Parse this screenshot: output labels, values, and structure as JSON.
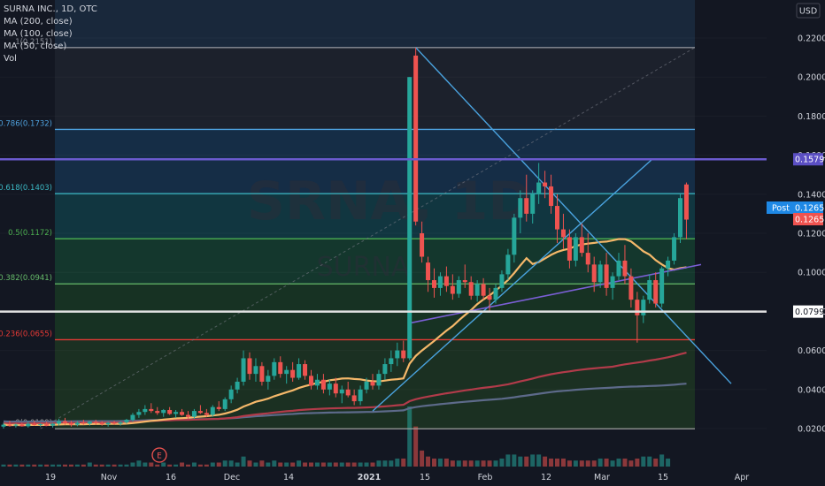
{
  "header": {
    "symbol_line": "SURNA INC., 1D, OTC",
    "indicators": [
      "MA (200, close)",
      "MA (100, close)",
      "MA (50, close)",
      "Vol"
    ]
  },
  "watermark": {
    "ticker": "SRNA, 1D",
    "name": "SURNA"
  },
  "currency_badge": "USD",
  "colors": {
    "background": "#131722",
    "up": "#26a69a",
    "down": "#ef5350",
    "ma50": "#f5b86a",
    "ma100": "#b23b4a",
    "ma200": "#5d6a8a",
    "trend_line": "#4aa3df",
    "channel_line": "#7b5fd6"
  },
  "chart_data": {
    "type": "candlestick",
    "y_axis": {
      "range": [
        0.01,
        0.235
      ],
      "ticks": [
        "0.2200",
        "0.2000",
        "0.1800",
        "0.1600",
        "0.1400",
        "0.1200",
        "0.1000",
        "0.0800",
        "0.0600",
        "0.0400",
        "0.0200"
      ]
    },
    "x_axis": {
      "ticks": [
        "19",
        "Nov",
        "16",
        "Dec",
        "14",
        "2021",
        "15",
        "Feb",
        "12",
        "Mar",
        "15",
        "Apr"
      ]
    },
    "price_labels": [
      {
        "label": "0.1579",
        "value": 0.1579,
        "color": "#5b4fc4"
      },
      {
        "label": "Post",
        "value": 0.1265,
        "color": "#1e88e5"
      },
      {
        "label": "0.1265",
        "value": 0.1265,
        "color": "#1e88e5"
      },
      {
        "label": "0.1265",
        "value": 0.1255,
        "color": "#ef5350"
      },
      {
        "label": "0.0799",
        "value": 0.0799,
        "color": "#ffffff"
      }
    ],
    "fibonacci": {
      "levels": [
        {
          "label": "1(0.2151)",
          "value": 0.2151,
          "color": "#8a8f99"
        },
        {
          "label": "0.786(0.1732)",
          "value": 0.1732,
          "color": "#4fa3e0"
        },
        {
          "label": "0.618(0.1403)",
          "value": 0.1403,
          "color": "#3cbac6"
        },
        {
          "label": "0.5(0.1172)",
          "value": 0.1172,
          "color": "#4caf50"
        },
        {
          "label": "0.382(0.0941)",
          "value": 0.0941,
          "color": "#66bb6a"
        },
        {
          "label": "0.236(0.0655)",
          "value": 0.0655,
          "color": "#e53935"
        },
        {
          "label": "0(0.0199)",
          "value": 0.0199,
          "color": "#9e9e9e"
        }
      ]
    },
    "horizontal_lines": [
      {
        "value": 0.1579,
        "color": "#6a5acd"
      },
      {
        "value": 0.0799,
        "color": "#e0e0e0"
      }
    ],
    "events": [
      {
        "label": "E"
      }
    ],
    "candles": [
      {
        "o": 0.021,
        "h": 0.023,
        "l": 0.02,
        "c": 0.022
      },
      {
        "o": 0.022,
        "h": 0.024,
        "l": 0.021,
        "c": 0.0215
      },
      {
        "o": 0.0215,
        "h": 0.0225,
        "l": 0.0205,
        "c": 0.022
      },
      {
        "o": 0.022,
        "h": 0.023,
        "l": 0.021,
        "c": 0.0212
      },
      {
        "o": 0.0212,
        "h": 0.0235,
        "l": 0.0205,
        "c": 0.0225
      },
      {
        "o": 0.0225,
        "h": 0.024,
        "l": 0.0215,
        "c": 0.0218
      },
      {
        "o": 0.0218,
        "h": 0.0228,
        "l": 0.0208,
        "c": 0.0222
      },
      {
        "o": 0.0222,
        "h": 0.0235,
        "l": 0.0212,
        "c": 0.0215
      },
      {
        "o": 0.0215,
        "h": 0.023,
        "l": 0.0205,
        "c": 0.0225
      },
      {
        "o": 0.0225,
        "h": 0.025,
        "l": 0.0215,
        "c": 0.0238
      },
      {
        "o": 0.0238,
        "h": 0.0255,
        "l": 0.022,
        "c": 0.0228
      },
      {
        "o": 0.0228,
        "h": 0.024,
        "l": 0.021,
        "c": 0.022
      },
      {
        "o": 0.022,
        "h": 0.0238,
        "l": 0.0212,
        "c": 0.023
      },
      {
        "o": 0.023,
        "h": 0.0245,
        "l": 0.022,
        "c": 0.0225
      },
      {
        "o": 0.0225,
        "h": 0.024,
        "l": 0.0215,
        "c": 0.0235
      },
      {
        "o": 0.0235,
        "h": 0.0245,
        "l": 0.022,
        "c": 0.0228
      },
      {
        "o": 0.0228,
        "h": 0.0238,
        "l": 0.0215,
        "c": 0.0222
      },
      {
        "o": 0.0222,
        "h": 0.0235,
        "l": 0.021,
        "c": 0.023
      },
      {
        "o": 0.023,
        "h": 0.024,
        "l": 0.022,
        "c": 0.0225
      },
      {
        "o": 0.0225,
        "h": 0.0238,
        "l": 0.0215,
        "c": 0.0232
      },
      {
        "o": 0.0232,
        "h": 0.025,
        "l": 0.0225,
        "c": 0.0245
      },
      {
        "o": 0.0245,
        "h": 0.028,
        "l": 0.0235,
        "c": 0.027
      },
      {
        "o": 0.027,
        "h": 0.03,
        "l": 0.0255,
        "c": 0.0285
      },
      {
        "o": 0.0285,
        "h": 0.032,
        "l": 0.027,
        "c": 0.03
      },
      {
        "o": 0.03,
        "h": 0.033,
        "l": 0.028,
        "c": 0.029
      },
      {
        "o": 0.029,
        "h": 0.031,
        "l": 0.027,
        "c": 0.028
      },
      {
        "o": 0.028,
        "h": 0.03,
        "l": 0.026,
        "c": 0.0295
      },
      {
        "o": 0.0295,
        "h": 0.031,
        "l": 0.027,
        "c": 0.0275
      },
      {
        "o": 0.0275,
        "h": 0.0295,
        "l": 0.0255,
        "c": 0.0285
      },
      {
        "o": 0.0285,
        "h": 0.03,
        "l": 0.0265,
        "c": 0.027
      },
      {
        "o": 0.027,
        "h": 0.029,
        "l": 0.025,
        "c": 0.026
      },
      {
        "o": 0.026,
        "h": 0.03,
        "l": 0.025,
        "c": 0.029
      },
      {
        "o": 0.029,
        "h": 0.032,
        "l": 0.0275,
        "c": 0.028
      },
      {
        "o": 0.028,
        "h": 0.03,
        "l": 0.026,
        "c": 0.027
      },
      {
        "o": 0.027,
        "h": 0.032,
        "l": 0.026,
        "c": 0.031
      },
      {
        "o": 0.031,
        "h": 0.034,
        "l": 0.029,
        "c": 0.03
      },
      {
        "o": 0.03,
        "h": 0.036,
        "l": 0.029,
        "c": 0.035
      },
      {
        "o": 0.035,
        "h": 0.042,
        "l": 0.033,
        "c": 0.04
      },
      {
        "o": 0.04,
        "h": 0.046,
        "l": 0.038,
        "c": 0.044
      },
      {
        "o": 0.044,
        "h": 0.06,
        "l": 0.042,
        "c": 0.056
      },
      {
        "o": 0.056,
        "h": 0.059,
        "l": 0.045,
        "c": 0.048
      },
      {
        "o": 0.048,
        "h": 0.056,
        "l": 0.044,
        "c": 0.052
      },
      {
        "o": 0.052,
        "h": 0.054,
        "l": 0.042,
        "c": 0.044
      },
      {
        "o": 0.044,
        "h": 0.05,
        "l": 0.04,
        "c": 0.047
      },
      {
        "o": 0.047,
        "h": 0.056,
        "l": 0.045,
        "c": 0.054
      },
      {
        "o": 0.054,
        "h": 0.057,
        "l": 0.046,
        "c": 0.048
      },
      {
        "o": 0.048,
        "h": 0.052,
        "l": 0.043,
        "c": 0.05
      },
      {
        "o": 0.05,
        "h": 0.054,
        "l": 0.044,
        "c": 0.046
      },
      {
        "o": 0.046,
        "h": 0.056,
        "l": 0.045,
        "c": 0.053
      },
      {
        "o": 0.053,
        "h": 0.055,
        "l": 0.045,
        "c": 0.047
      },
      {
        "o": 0.047,
        "h": 0.05,
        "l": 0.04,
        "c": 0.042
      },
      {
        "o": 0.042,
        "h": 0.048,
        "l": 0.04,
        "c": 0.045
      },
      {
        "o": 0.045,
        "h": 0.048,
        "l": 0.038,
        "c": 0.04
      },
      {
        "o": 0.04,
        "h": 0.045,
        "l": 0.037,
        "c": 0.043
      },
      {
        "o": 0.043,
        "h": 0.046,
        "l": 0.036,
        "c": 0.038
      },
      {
        "o": 0.038,
        "h": 0.042,
        "l": 0.033,
        "c": 0.04
      },
      {
        "o": 0.04,
        "h": 0.044,
        "l": 0.036,
        "c": 0.037
      },
      {
        "o": 0.037,
        "h": 0.04,
        "l": 0.032,
        "c": 0.034
      },
      {
        "o": 0.034,
        "h": 0.042,
        "l": 0.032,
        "c": 0.04
      },
      {
        "o": 0.04,
        "h": 0.046,
        "l": 0.038,
        "c": 0.044
      },
      {
        "o": 0.044,
        "h": 0.048,
        "l": 0.04,
        "c": 0.042
      },
      {
        "o": 0.042,
        "h": 0.05,
        "l": 0.04,
        "c": 0.048
      },
      {
        "o": 0.048,
        "h": 0.056,
        "l": 0.045,
        "c": 0.053
      },
      {
        "o": 0.053,
        "h": 0.06,
        "l": 0.049,
        "c": 0.056
      },
      {
        "o": 0.056,
        "h": 0.064,
        "l": 0.052,
        "c": 0.06
      },
      {
        "o": 0.06,
        "h": 0.065,
        "l": 0.054,
        "c": 0.056
      },
      {
        "o": 0.056,
        "h": 0.2,
        "l": 0.055,
        "c": 0.2
      },
      {
        "o": 0.211,
        "h": 0.215,
        "l": 0.124,
        "c": 0.126
      },
      {
        "o": 0.12,
        "h": 0.126,
        "l": 0.105,
        "c": 0.108
      },
      {
        "o": 0.105,
        "h": 0.108,
        "l": 0.09,
        "c": 0.096
      },
      {
        "o": 0.096,
        "h": 0.102,
        "l": 0.087,
        "c": 0.092
      },
      {
        "o": 0.092,
        "h": 0.1,
        "l": 0.088,
        "c": 0.098
      },
      {
        "o": 0.098,
        "h": 0.103,
        "l": 0.09,
        "c": 0.093
      },
      {
        "o": 0.093,
        "h": 0.099,
        "l": 0.086,
        "c": 0.089
      },
      {
        "o": 0.089,
        "h": 0.098,
        "l": 0.087,
        "c": 0.096
      },
      {
        "o": 0.096,
        "h": 0.104,
        "l": 0.092,
        "c": 0.095
      },
      {
        "o": 0.095,
        "h": 0.098,
        "l": 0.086,
        "c": 0.088
      },
      {
        "o": 0.088,
        "h": 0.096,
        "l": 0.085,
        "c": 0.094
      },
      {
        "o": 0.094,
        "h": 0.097,
        "l": 0.086,
        "c": 0.088
      },
      {
        "o": 0.088,
        "h": 0.092,
        "l": 0.08,
        "c": 0.086
      },
      {
        "o": 0.086,
        "h": 0.094,
        "l": 0.084,
        "c": 0.092
      },
      {
        "o": 0.092,
        "h": 0.101,
        "l": 0.09,
        "c": 0.099
      },
      {
        "o": 0.099,
        "h": 0.112,
        "l": 0.096,
        "c": 0.109
      },
      {
        "o": 0.109,
        "h": 0.13,
        "l": 0.105,
        "c": 0.128
      },
      {
        "o": 0.128,
        "h": 0.142,
        "l": 0.12,
        "c": 0.138
      },
      {
        "o": 0.138,
        "h": 0.15,
        "l": 0.126,
        "c": 0.13
      },
      {
        "o": 0.13,
        "h": 0.142,
        "l": 0.125,
        "c": 0.14
      },
      {
        "o": 0.14,
        "h": 0.156,
        "l": 0.135,
        "c": 0.146
      },
      {
        "o": 0.146,
        "h": 0.152,
        "l": 0.138,
        "c": 0.144
      },
      {
        "o": 0.144,
        "h": 0.15,
        "l": 0.13,
        "c": 0.134
      },
      {
        "o": 0.134,
        "h": 0.14,
        "l": 0.115,
        "c": 0.122
      },
      {
        "o": 0.122,
        "h": 0.13,
        "l": 0.112,
        "c": 0.118
      },
      {
        "o": 0.118,
        "h": 0.122,
        "l": 0.102,
        "c": 0.106
      },
      {
        "o": 0.106,
        "h": 0.12,
        "l": 0.103,
        "c": 0.118
      },
      {
        "o": 0.118,
        "h": 0.125,
        "l": 0.108,
        "c": 0.11
      },
      {
        "o": 0.11,
        "h": 0.12,
        "l": 0.1,
        "c": 0.104
      },
      {
        "o": 0.104,
        "h": 0.108,
        "l": 0.09,
        "c": 0.095
      },
      {
        "o": 0.095,
        "h": 0.106,
        "l": 0.092,
        "c": 0.104
      },
      {
        "o": 0.104,
        "h": 0.11,
        "l": 0.088,
        "c": 0.092
      },
      {
        "o": 0.092,
        "h": 0.1,
        "l": 0.086,
        "c": 0.098
      },
      {
        "o": 0.098,
        "h": 0.11,
        "l": 0.096,
        "c": 0.106
      },
      {
        "o": 0.106,
        "h": 0.114,
        "l": 0.094,
        "c": 0.098
      },
      {
        "o": 0.098,
        "h": 0.102,
        "l": 0.082,
        "c": 0.086
      },
      {
        "o": 0.086,
        "h": 0.09,
        "l": 0.064,
        "c": 0.078
      },
      {
        "o": 0.078,
        "h": 0.088,
        "l": 0.074,
        "c": 0.086
      },
      {
        "o": 0.086,
        "h": 0.099,
        "l": 0.084,
        "c": 0.096
      },
      {
        "o": 0.096,
        "h": 0.1,
        "l": 0.082,
        "c": 0.084
      },
      {
        "o": 0.084,
        "h": 0.103,
        "l": 0.082,
        "c": 0.102
      },
      {
        "o": 0.102,
        "h": 0.108,
        "l": 0.098,
        "c": 0.106
      },
      {
        "o": 0.106,
        "h": 0.12,
        "l": 0.104,
        "c": 0.118
      },
      {
        "o": 0.118,
        "h": 0.14,
        "l": 0.115,
        "c": 0.138
      },
      {
        "o": 0.145,
        "h": 0.146,
        "l": 0.117,
        "c": 0.127
      }
    ],
    "volume": [
      1,
      1,
      1,
      1,
      1,
      1,
      1,
      1,
      1,
      1,
      1,
      1,
      1,
      1,
      2,
      1,
      1,
      1,
      1,
      1,
      1,
      2,
      3,
      2,
      2,
      1,
      2,
      1,
      1,
      2,
      1,
      2,
      1,
      1,
      2,
      2,
      3,
      3,
      2,
      5,
      3,
      2,
      3,
      2,
      3,
      2,
      2,
      2,
      3,
      2,
      2,
      2,
      2,
      2,
      2,
      2,
      2,
      2,
      2,
      2,
      2,
      3,
      3,
      3,
      4,
      4,
      30,
      20,
      8,
      5,
      4,
      4,
      4,
      3,
      3,
      3,
      3,
      3,
      3,
      3,
      3,
      4,
      6,
      6,
      5,
      5,
      6,
      6,
      5,
      4,
      4,
      4,
      3,
      3,
      3,
      3,
      3,
      4,
      4,
      3,
      4,
      4,
      3,
      4,
      5,
      5,
      4,
      6,
      4
    ]
  }
}
